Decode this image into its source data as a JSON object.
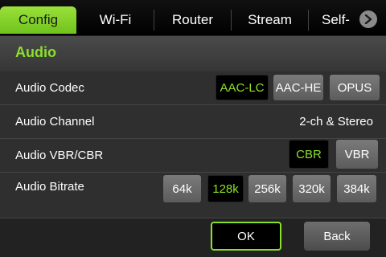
{
  "tabs": [
    {
      "label": "Config",
      "active": true
    },
    {
      "label": "Wi-Fi",
      "active": false
    },
    {
      "label": "Router",
      "active": false
    },
    {
      "label": "Stream",
      "active": false
    },
    {
      "label": "Self-",
      "active": false
    }
  ],
  "tab_scroll_icon": "chevron-right-icon",
  "section": {
    "title": "Audio"
  },
  "rows": {
    "codec": {
      "label": "Audio Codec",
      "options": [
        "AAC-LC",
        "AAC-HE",
        "OPUS"
      ],
      "selected": "AAC-LC"
    },
    "channel": {
      "label": "Audio Channel",
      "value": "2-ch & Stereo"
    },
    "vbr": {
      "label": "Audio VBR/CBR",
      "options": [
        "CBR",
        "VBR"
      ],
      "selected": "CBR"
    },
    "bitrate": {
      "label": "Audio Bitrate",
      "options": [
        "64k",
        "128k",
        "256k",
        "320k",
        "384k"
      ],
      "selected": "128k"
    }
  },
  "buttons": {
    "ok": "OK",
    "back": "Back"
  },
  "colors": {
    "accent": "#8be02a",
    "background": "#2a2a2a",
    "option_bg": "#6a6a6a",
    "selected_bg": "#000000"
  }
}
